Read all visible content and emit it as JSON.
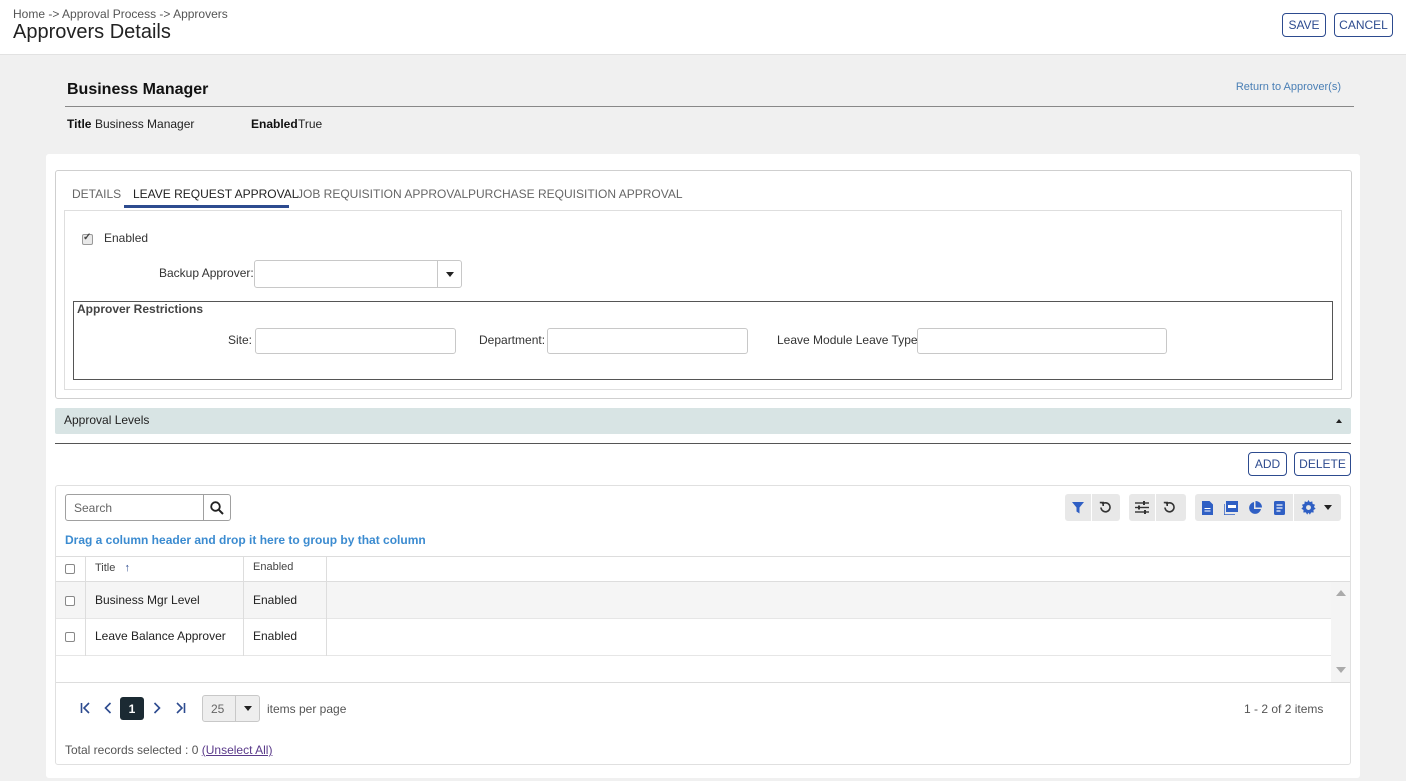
{
  "header": {
    "breadcrumb": "Home -> Approval Process -> Approvers",
    "title": "Approvers Details",
    "save_label": "SAVE",
    "cancel_label": "CANCEL"
  },
  "record": {
    "name": "Business Manager",
    "return_link": "Return to Approver(s)",
    "title_label": "Title",
    "title_value": "Business Manager",
    "enabled_label": "Enabled",
    "enabled_value": "True"
  },
  "tabs": [
    {
      "label": "DETAILS",
      "active": false
    },
    {
      "label": "LEAVE REQUEST APPROVAL",
      "active": true
    },
    {
      "label": "JOB REQUISITION APPROVAL",
      "active": false
    },
    {
      "label": "PURCHASE REQUISITION APPROVAL",
      "active": false
    }
  ],
  "form": {
    "enabled_label": "Enabled",
    "enabled_checked": true,
    "backup_approver_label": "Backup Approver:",
    "backup_approver_value": "",
    "restrictions_legend": "Approver Restrictions",
    "site_label": "Site:",
    "department_label": "Department:",
    "leave_type_label": "Leave Module Leave Type:"
  },
  "approval_levels": {
    "section_title": "Approval Levels",
    "add_label": "ADD",
    "delete_label": "DELETE",
    "search_placeholder": "Search",
    "group_hint": "Drag a column header and drop it here to group by that column",
    "columns": [
      "Title",
      "Enabled"
    ],
    "sort_indicator": "↑",
    "rows": [
      {
        "title": "Business Mgr Level",
        "enabled": "Enabled"
      },
      {
        "title": "Leave Balance Approver",
        "enabled": "Enabled"
      }
    ],
    "pager": {
      "current_page": "1",
      "page_size": "25",
      "items_per_page_label": "items per page",
      "summary": "1 - 2 of 2 items"
    },
    "footer": {
      "selected_text": "Total records selected : 0",
      "unselect_label": "(Unselect All)"
    }
  },
  "icons": {
    "search": "search-icon",
    "filter": "filter-icon",
    "reset": "reset-icon",
    "columns": "column-settings-icon",
    "excel": "excel-export-icon",
    "pdf": "pdf-export-icon",
    "chart": "chart-icon",
    "report": "report-icon",
    "gear": "gear-icon"
  },
  "colors": {
    "accent": "#2d4b8f",
    "link": "#3b8bd0",
    "section_bg": "#d8e4e4",
    "icon_blue": "#2f5fc4"
  }
}
